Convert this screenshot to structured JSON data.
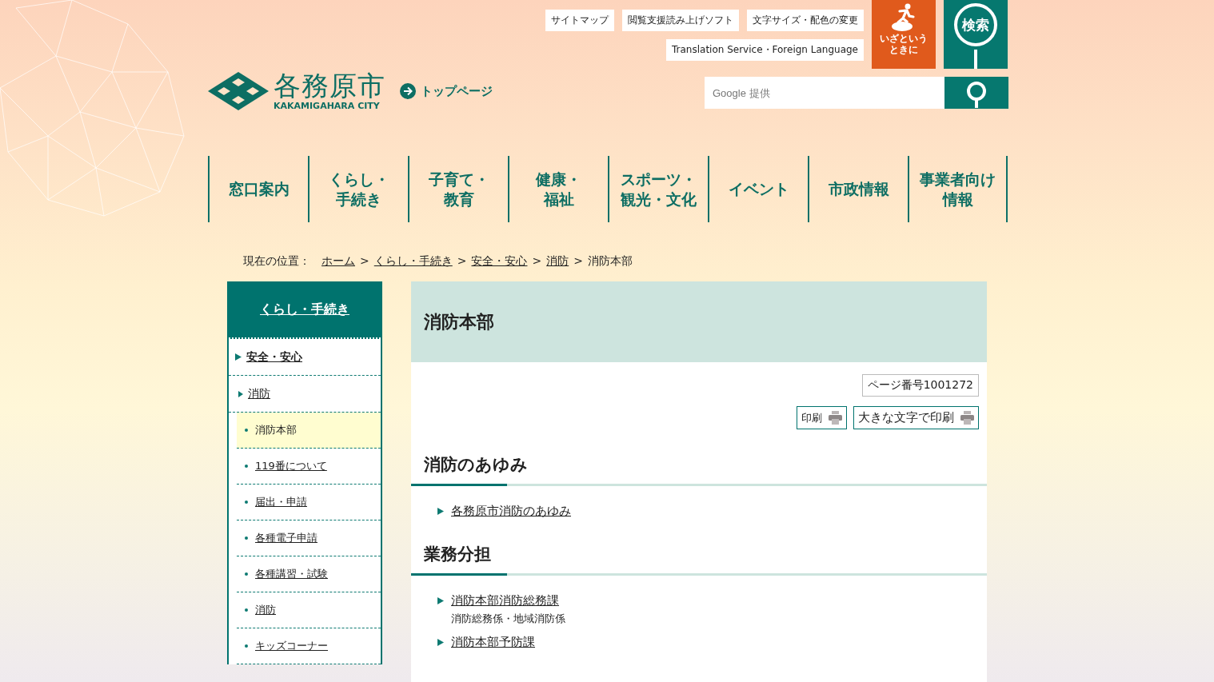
{
  "utility_links": [
    "サイトマップ",
    "閲覧支援読み上げソフト",
    "文字サイズ・配色の変更",
    "Translation Service・Foreign Language"
  ],
  "emergency_button": "いざというときに",
  "search_button": "検索",
  "logo": {
    "name": "各務原市",
    "subtitle": "KAKAMIGAHARA CITY"
  },
  "top_page_link": "トップページ",
  "search": {
    "placeholder": "Google 提供"
  },
  "nav": [
    {
      "lines": [
        "窓口案内"
      ]
    },
    {
      "lines": [
        "くらし・",
        "手続き"
      ]
    },
    {
      "lines": [
        "子育て・",
        "教育"
      ]
    },
    {
      "lines": [
        "健康・",
        "福祉"
      ]
    },
    {
      "lines": [
        "スポーツ・",
        "観光・文化"
      ]
    },
    {
      "lines": [
        "イベント"
      ]
    },
    {
      "lines": [
        "市政情報"
      ]
    },
    {
      "lines": [
        "事業者向け",
        "情報"
      ]
    }
  ],
  "breadcrumb": {
    "label": "現在の位置：",
    "items": [
      {
        "text": "ホーム",
        "link": true
      },
      {
        "separator": ">",
        "text": "くらし・手続き",
        "link": true
      },
      {
        "separator": ">",
        "text": "安全・安心",
        "link": true
      },
      {
        "separator": ">",
        "text": "消防",
        "link": true
      },
      {
        "separator": ">",
        "text": "消防本部",
        "link": false
      }
    ]
  },
  "sidebar": {
    "title": "くらし・手続き",
    "items": [
      {
        "label": "安全・安心",
        "children": [
          {
            "label": "消防",
            "children": [
              {
                "label": "消防本部",
                "selected": true
              },
              {
                "label": "119番について",
                "selected": false
              },
              {
                "label": "届出・申請",
                "selected": false
              },
              {
                "label": "各種電子申請",
                "selected": false
              },
              {
                "label": "各種講習・試験",
                "selected": false
              },
              {
                "label": "消防",
                "selected": false
              },
              {
                "label": "キッズコーナー",
                "selected": false
              }
            ]
          }
        ]
      }
    ]
  },
  "main": {
    "title": "消防本部",
    "page_number": "ページ番号1001272",
    "print_buttons": [
      "印刷",
      "大きな文字で印刷"
    ],
    "sections": [
      {
        "heading": "消防のあゆみ",
        "links": [
          {
            "text": "各務原市消防のあゆみ"
          }
        ]
      },
      {
        "heading": "業務分担",
        "links": [
          {
            "text": "消防本部消防総務課",
            "note": "消防総務係・地域消防係"
          },
          {
            "text": "消防本部予防課"
          }
        ]
      }
    ]
  }
}
